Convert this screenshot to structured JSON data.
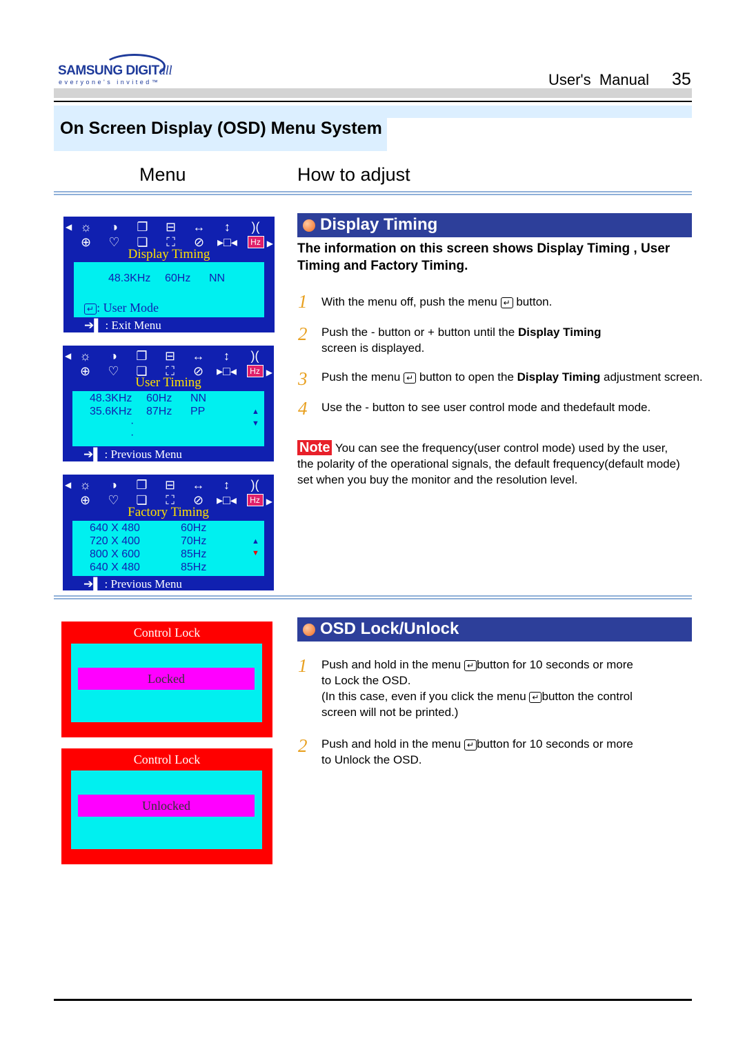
{
  "header": {
    "logo_main": "SAMSUNG DIGIT",
    "logo_all": "all",
    "logo_tagline": "everyone's invited™",
    "manual": "User's  Manual",
    "page": "35"
  },
  "title": "On Screen Display (OSD) Menu System",
  "columns": {
    "menu": "Menu",
    "how": "How to adjust"
  },
  "osd_icons": [
    "☼",
    "◑",
    "❐",
    "⊟",
    "↔",
    "↕",
    ")(",
    "⊕",
    "♡",
    "❏",
    "⛶",
    "⊘",
    "▸□◂",
    "Hz"
  ],
  "osd1": {
    "title": "Display Timing",
    "values": [
      "48.3KHz",
      "60Hz",
      "NN"
    ],
    "user_mode": ": User Mode",
    "exit": ": Exit Menu"
  },
  "osd2": {
    "title": "User Timing",
    "rows": [
      [
        "48.3KHz",
        "60Hz",
        "NN"
      ],
      [
        "35.6KHz",
        "87Hz",
        "PP"
      ]
    ],
    "dots": [
      "·",
      "·"
    ],
    "prev": ": Previous Menu"
  },
  "osd3": {
    "title": "Factory Timing",
    "rows": [
      [
        "640 X 480",
        "60Hz"
      ],
      [
        "720 X 400",
        "70Hz"
      ],
      [
        "800 X 600",
        "85Hz"
      ],
      [
        "640 X 480",
        "85Hz"
      ]
    ],
    "prev": ": Previous Menu"
  },
  "display_timing": {
    "heading": "Display Timing",
    "intro": "The information on this screen shows Display Timing , User Timing and Factory Timing.",
    "steps": [
      {
        "n": "1",
        "a": "With the menu off, push the menu ",
        "b": " button."
      },
      {
        "n": "2",
        "a": "Push the - button or  + button until the ",
        "bold": "Display Timing",
        "c": "screen is displayed."
      },
      {
        "n": "3",
        "a": "Push the menu ",
        "b": " button to open the ",
        "bold": "Display Timing",
        "c": " adjustment screen."
      },
      {
        "n": "4",
        "a": "Use the - button to see user control mode and thedefault mode."
      }
    ],
    "note_label": "Note",
    "note": "You can see the frequency(user control mode) used by the user,",
    "note2": "the polarity of the operational signals, the default frequency(default mode)",
    "note3": "set when you buy the monitor and the resolution level."
  },
  "osd_lock": {
    "heading": "OSD Lock/Unlock",
    "step1": {
      "n": "1",
      "a": "Push and hold in the menu ",
      "b": "button for 10 seconds or more",
      "c": "to Lock  the OSD.",
      "d": "(In this case, even if you click the menu ",
      "e": "button the control",
      "f": "screen will not be printed.)"
    },
    "step2": {
      "n": "2",
      "a": "Push and hold in the menu ",
      "b": "button for 10 seconds or more",
      "c": "to Unlock the OSD."
    },
    "panels": [
      {
        "title": "Control Lock",
        "state": "Locked"
      },
      {
        "title": "Control Lock",
        "state": "Unlocked"
      }
    ]
  },
  "key_glyph": "↵",
  "exit_glyph": "➔▌"
}
